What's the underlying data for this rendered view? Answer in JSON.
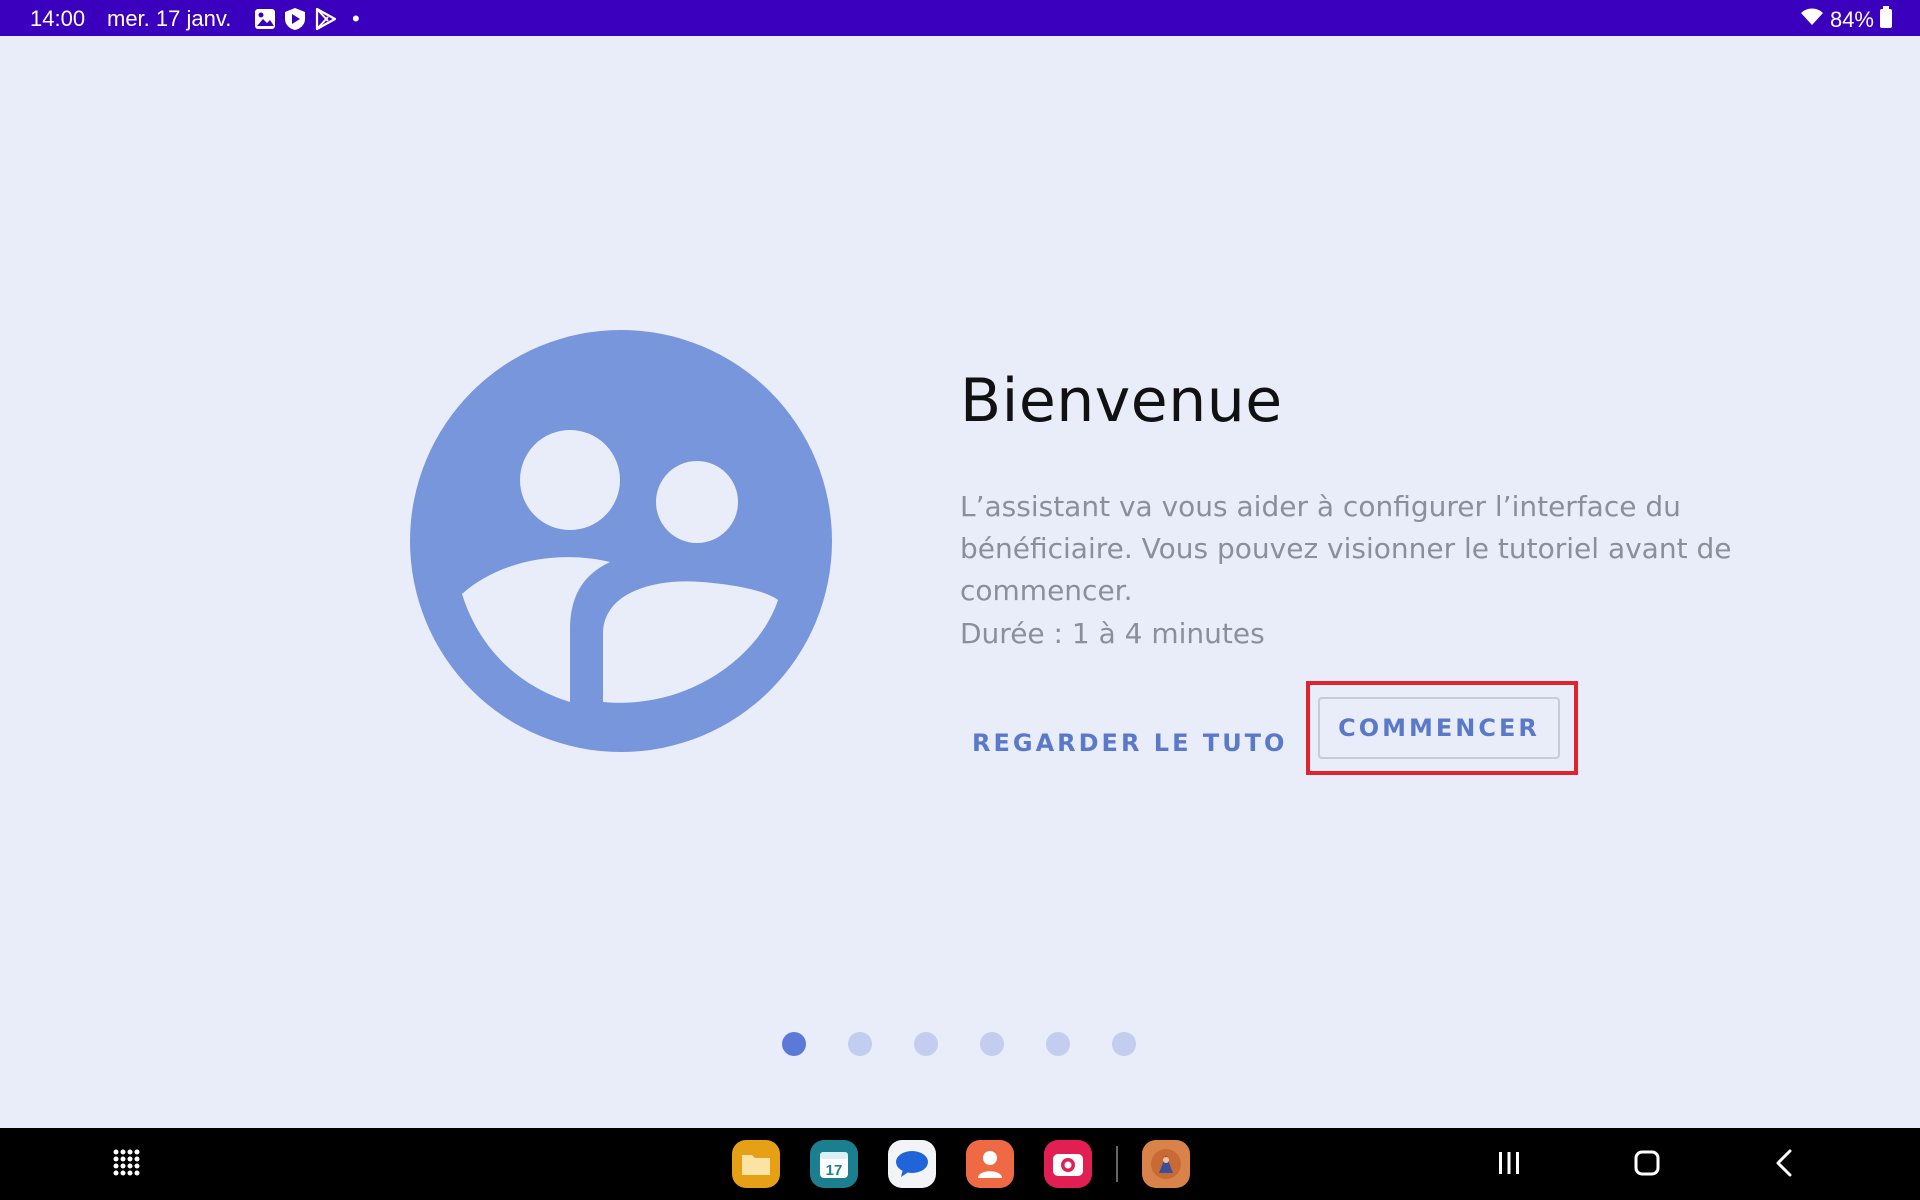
{
  "status_bar": {
    "time": "14:00",
    "date": "mer. 17 janv.",
    "battery": "84%",
    "icons": [
      "gallery-icon",
      "shield-play-icon",
      "play-store-icon",
      "notification-dot-icon",
      "wifi-icon",
      "battery-icon"
    ],
    "notification_dot": "•"
  },
  "welcome": {
    "title": "Bienvenue",
    "description": "L’assistant va vous aider à configurer l’interface du bénéficiaire. Vous pouvez visionner le tutoriel avant de commencer.",
    "duration": "Durée : 1 à 4 minutes",
    "tutorial_button": "REGARDER LE TUTO",
    "start_button": "COMMENCER",
    "illustration_icon": "users-group-icon"
  },
  "pager": {
    "total_pages": 6,
    "current_page": 1
  },
  "dock": {
    "apps": [
      "files-app-icon",
      "calendar-app-icon",
      "messages-app-icon",
      "contacts-app-icon",
      "camera-app-icon",
      "game-app-icon"
    ],
    "calendar_day": "17"
  },
  "navigation": [
    "app-drawer-icon",
    "recents-icon",
    "home-icon",
    "back-icon"
  ],
  "colors": {
    "status_bar": "#3a00bd",
    "background": "#e9edfa",
    "accent": "#5b79c9",
    "illustration": "#7896dc",
    "highlight": "#e0232f"
  }
}
